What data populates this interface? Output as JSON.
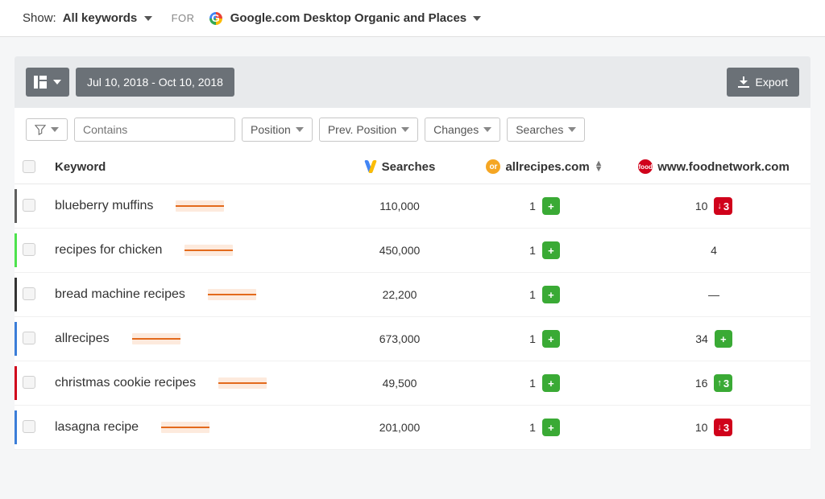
{
  "topbar": {
    "show_label": "Show:",
    "show_value": "All keywords",
    "for_label": "FOR",
    "source_value": "Google.com Desktop Organic and Places"
  },
  "toolbar": {
    "date_range": "Jul 10, 2018 - Oct 10, 2018",
    "export_label": "Export"
  },
  "filters": {
    "contains_placeholder": "Contains",
    "position": "Position",
    "prev_position": "Prev. Position",
    "changes": "Changes",
    "searches": "Searches"
  },
  "columns": {
    "keyword": "Keyword",
    "searches": "Searches",
    "site1": "allrecipes.com",
    "site2": "www.foodnetwork.com"
  },
  "rows": [
    {
      "stripe_color": "#5f5f5f",
      "keyword": "blueberry muffins",
      "searches": "110,000",
      "site1_pos": "1",
      "site1_change": {
        "type": "plus"
      },
      "site2_pos": "10",
      "site2_change": {
        "type": "down",
        "value": "3"
      }
    },
    {
      "stripe_color": "#4de24d",
      "keyword": "recipes for chicken",
      "searches": "450,000",
      "site1_pos": "1",
      "site1_change": {
        "type": "plus"
      },
      "site2_pos": "4",
      "site2_change": {
        "type": "none"
      }
    },
    {
      "stripe_color": "#333",
      "keyword": "bread machine recipes",
      "searches": "22,200",
      "site1_pos": "1",
      "site1_change": {
        "type": "plus"
      },
      "site2_pos": "—",
      "site2_change": {
        "type": "none"
      }
    },
    {
      "stripe_color": "#3b7dd8",
      "keyword": "allrecipes",
      "searches": "673,000",
      "site1_pos": "1",
      "site1_change": {
        "type": "plus"
      },
      "site2_pos": "34",
      "site2_change": {
        "type": "plus"
      }
    },
    {
      "stripe_color": "#d0021b",
      "keyword": "christmas cookie recipes",
      "searches": "49,500",
      "site1_pos": "1",
      "site1_change": {
        "type": "plus"
      },
      "site2_pos": "16",
      "site2_change": {
        "type": "up",
        "value": "3"
      }
    },
    {
      "stripe_color": "#3b7dd8",
      "keyword": "lasagna recipe",
      "searches": "201,000",
      "site1_pos": "1",
      "site1_change": {
        "type": "plus"
      },
      "site2_pos": "10",
      "site2_change": {
        "type": "down",
        "value": "3"
      }
    }
  ]
}
